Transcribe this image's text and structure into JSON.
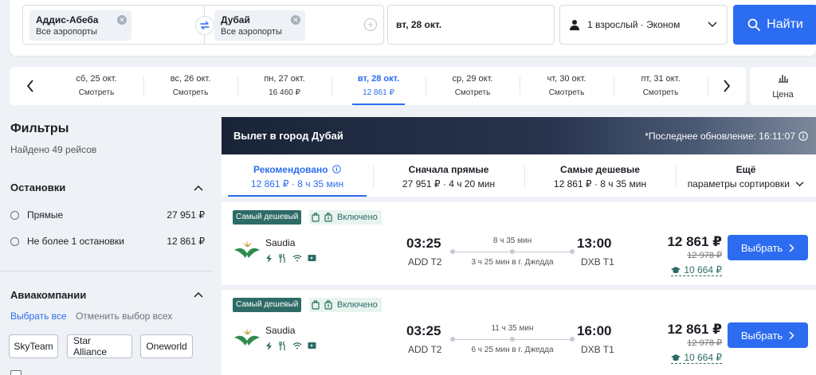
{
  "search": {
    "from_city": "Аддис-Абеба",
    "from_sub": "Все аэропорты",
    "to_city": "Дубай",
    "to_sub": "Все аэропорты",
    "date": "вт, 28 окт.",
    "passengers": "1 взрослый · Эконом",
    "find_label": "Найти"
  },
  "date_strip": {
    "days": [
      {
        "date": "сб, 25 окт.",
        "price": "Смотреть"
      },
      {
        "date": "вс, 26 окт.",
        "price": "Смотреть"
      },
      {
        "date": "пн, 27 окт.",
        "price": "16 460 ₽"
      },
      {
        "date": "вт, 28 окт.",
        "price": "12 861 ₽"
      },
      {
        "date": "ср, 29 окт.",
        "price": "Смотреть"
      },
      {
        "date": "чт, 30 окт.",
        "price": "Смотреть"
      },
      {
        "date": "пт, 31 окт.",
        "price": "Смотреть"
      }
    ],
    "price_toggle": "Цена"
  },
  "filters": {
    "title": "Фильтры",
    "found": "Найдено 49 рейсов",
    "stops_title": "Остановки",
    "stops": [
      {
        "label": "Прямые",
        "price": "27 951 ₽"
      },
      {
        "label": "Не более 1 остановки",
        "price": "12 861 ₽"
      }
    ],
    "airlines_title": "Авиакомпании",
    "select_all": "Выбрать все",
    "deselect_all": "Отменить выбор всех",
    "alliances": [
      "SkyTeam",
      "Star Alliance",
      "Oneworld"
    ]
  },
  "results": {
    "hero_title": "Вылет в город Дубай",
    "last_update": "*Последнее обновление: 16:11:07",
    "sort": [
      {
        "title": "Рекомендовано",
        "sub": "12 861 ₽ · 8 ч 35 мин"
      },
      {
        "title": "Сначала прямые",
        "sub": "27 951 ₽ · 4 ч 20 мин"
      },
      {
        "title": "Самые дешевые",
        "sub": "12 861 ₽ · 8 ч 35 мин"
      },
      {
        "title": "Ещё",
        "sub": "параметры сортировки"
      }
    ],
    "flights": [
      {
        "badge": "Самый дешевый",
        "included": "Включено",
        "airline": "Saudia",
        "dep_time": "03:25",
        "dep_code": "ADD T2",
        "duration": "8 ч 35 мин",
        "stop": "3 ч 25 мин в г. Джедда",
        "arr_time": "13:00",
        "arr_code": "DXB T1",
        "price": "12 861 ₽",
        "old_price": "12 978 ₽",
        "club_price": "10 664 ₽",
        "choose": "Выбрать"
      },
      {
        "badge": "Самый дешевый",
        "included": "Включено",
        "airline": "Saudia",
        "dep_time": "03:25",
        "dep_code": "ADD T2",
        "duration": "11 ч 35 мин",
        "stop": "6 ч 25 мин в г. Джедда",
        "arr_time": "16:00",
        "arr_code": "DXB T1",
        "price": "12 861 ₽",
        "old_price": "12 978 ₽",
        "club_price": "10 664 ₽",
        "choose": "Выбрать"
      }
    ]
  },
  "colors": {
    "accent": "#2c6cf0",
    "badge_green": "#2d6b66",
    "hero_dark": "#1a2438"
  }
}
